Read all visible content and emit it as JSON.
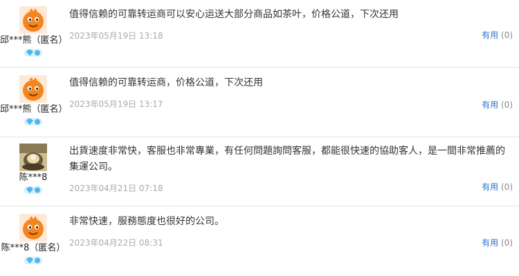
{
  "reviews": [
    {
      "username": "邱***熊（匿名）",
      "avatar": "cartoon-avatar-icon",
      "comment": "值得信赖的可靠转运商可以安心运送大部分商品如茶叶，价格公道，下次还用",
      "date": "2023年05月19日",
      "time": "13:18",
      "helpful_label": "有用",
      "helpful_count": "(0)"
    },
    {
      "username": "邱***熊（匿名）",
      "avatar": "cartoon-avatar-icon",
      "comment": "值得信赖的可靠转运商，价格公道，下次还用",
      "date": "2023年05月19日",
      "time": "13:17",
      "helpful_label": "有用",
      "helpful_count": "(0)"
    },
    {
      "username": "陈***8",
      "avatar": "photo-avatar-icon",
      "comment": "出貨速度非常快，客服也非常專業，有任何問題詢問客服，都能很快速的協助客人，是一間非常推薦的\n集運公司。",
      "date": "2023年04月21日",
      "time": "07:18",
      "helpful_label": "有用",
      "helpful_count": "(0)"
    },
    {
      "username": "陈***8（匿名）",
      "avatar": "cartoon-avatar-icon",
      "comment": "非常快速，服務態度也很好的公司。",
      "date": "2023年04月22日",
      "time": "08:31",
      "helpful_label": "有用",
      "helpful_count": "(0)"
    }
  ],
  "colors": {
    "link": "#2f74c3",
    "meta": "#aaaaaa",
    "avatar_orange": "#f5861f",
    "vip_blue": "#4fb7ec"
  }
}
